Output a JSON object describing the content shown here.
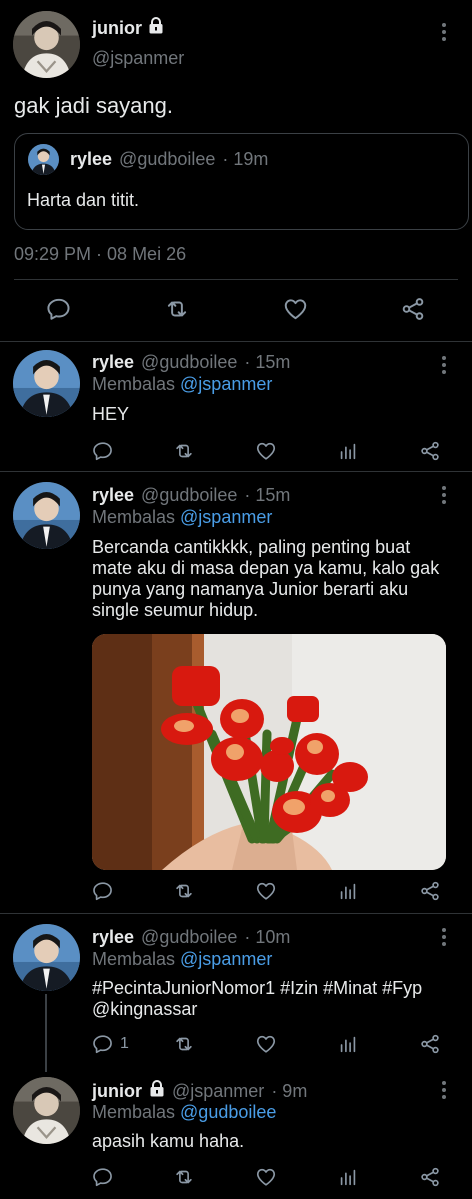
{
  "main_tweet": {
    "name": "junior",
    "handle": "@jspanmer",
    "text": "gak jadi sayang.",
    "timestamp": "09:29 PM · 08 Mei 26",
    "quote": {
      "name": "rylee",
      "handle": "@gudboilee",
      "time": "· 19m",
      "text": "Harta dan titit."
    }
  },
  "replies": [
    {
      "name": "rylee",
      "handle": "@gudboilee",
      "time": "· 15m",
      "replying_label": "Membalas",
      "replying_to": "@jspanmer",
      "text": "HEY",
      "reply_count": ""
    },
    {
      "name": "rylee",
      "handle": "@gudboilee",
      "time": "· 15m",
      "replying_label": "Membalas",
      "replying_to": "@jspanmer",
      "text_lines": [
        "Bercanda cantikkkk, paling penting buat",
        "mate aku di masa depan ya kamu, kalo gak",
        "punya yang namanya Junior berarti aku",
        "single seumur hidup."
      ],
      "reply_count": ""
    },
    {
      "name": "rylee",
      "handle": "@gudboilee",
      "time": "· 10m",
      "replying_label": "Membalas",
      "replying_to": "@jspanmer",
      "hashtags_line": "#PecintaJuniorNomor1 #Izin #Minat #Fyp",
      "mention_line": "@kingnassar",
      "reply_count": "1"
    },
    {
      "name": "junior",
      "handle": "@jspanmer",
      "time": "· 9m",
      "replying_label": "Membalas",
      "replying_to": "@gudboilee",
      "text": "apasih kamu haha.",
      "reply_count": ""
    }
  ],
  "icons": {
    "reply": "reply-icon",
    "retweet": "retweet-icon",
    "like": "like-icon",
    "analytics": "analytics-icon",
    "share": "share-icon",
    "more": "more-icon",
    "lock": "lock-icon"
  },
  "colors": {
    "background": "#000000",
    "text": "#e7e9ea",
    "muted": "#71767b",
    "link": "#4a9de6",
    "divider": "#2f3336"
  }
}
